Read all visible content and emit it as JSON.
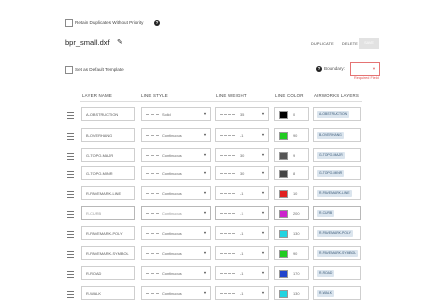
{
  "retain": {
    "label": "Retain Duplicates Without Priority",
    "help_icon": "help-icon"
  },
  "file": {
    "name": "bpr_small.dxf",
    "edit_icon": "pencil-icon"
  },
  "actions": {
    "duplicate": "DUPLICATE",
    "delete": "DELETE",
    "save": "SAVE"
  },
  "template": {
    "label": "Set as Default Template"
  },
  "boundary": {
    "label": "Boundary:",
    "value": "",
    "required_text": "Required Field"
  },
  "headers": {
    "layer_name": "LAYER NAME",
    "line_style": "LINE STYLE",
    "line_weight": "LINE WEIGHT",
    "line_color": "LINE COLOR",
    "airworks_layers": "AIRWORKS LAYERS"
  },
  "rows": [
    {
      "name": "A-OBSTRUCTION",
      "style": "Solid",
      "weight": "35",
      "color": "#000000",
      "color_num": "0",
      "layer": "A-OBSTRUCTION"
    },
    {
      "name": "B-OVERHANG",
      "style": "Continuous",
      "weight": "-1",
      "color": "#22cc22",
      "color_num": "90",
      "layer": "B-OVERHANG"
    },
    {
      "name": "G-TOPO-MAJR",
      "style": "Continuous",
      "weight": "30",
      "color": "#555555",
      "color_num": "9",
      "layer": "G-TOPO-MAJR"
    },
    {
      "name": "G-TOPO-MINR",
      "style": "Continuous",
      "weight": "30",
      "color": "#444444",
      "color_num": "8",
      "layer": "G-TOPO-MINR"
    },
    {
      "name": "R-PAVEMARK-LINE",
      "style": "Continuous",
      "weight": "-1",
      "color": "#e02020",
      "color_num": "10",
      "layer": "R-PAVEMARK-LINE"
    },
    {
      "name": "R-CURB",
      "style": "Continuous",
      "weight": "-1",
      "color": "#cc22cc",
      "color_num": "200",
      "layer": "R-CURB"
    },
    {
      "name": "R-PAVEMARK-POLY",
      "style": "Continuous",
      "weight": "-1",
      "color": "#22d4e0",
      "color_num": "130",
      "layer": "R-PAVEMARK-POLY"
    },
    {
      "name": "R-PAVEMARK-SYMBOL",
      "style": "Continuous",
      "weight": "-1",
      "color": "#22cc22",
      "color_num": "90",
      "layer": "R-PAVEMARK-SYMBOL"
    },
    {
      "name": "R-ROAD",
      "style": "Continuous",
      "weight": "-1",
      "color": "#2244cc",
      "color_num": "170",
      "layer": "R-ROAD"
    },
    {
      "name": "R-WALK",
      "style": "Continuous",
      "weight": "-1",
      "color": "#22d4e0",
      "color_num": "130",
      "layer": "R-WALK"
    }
  ]
}
